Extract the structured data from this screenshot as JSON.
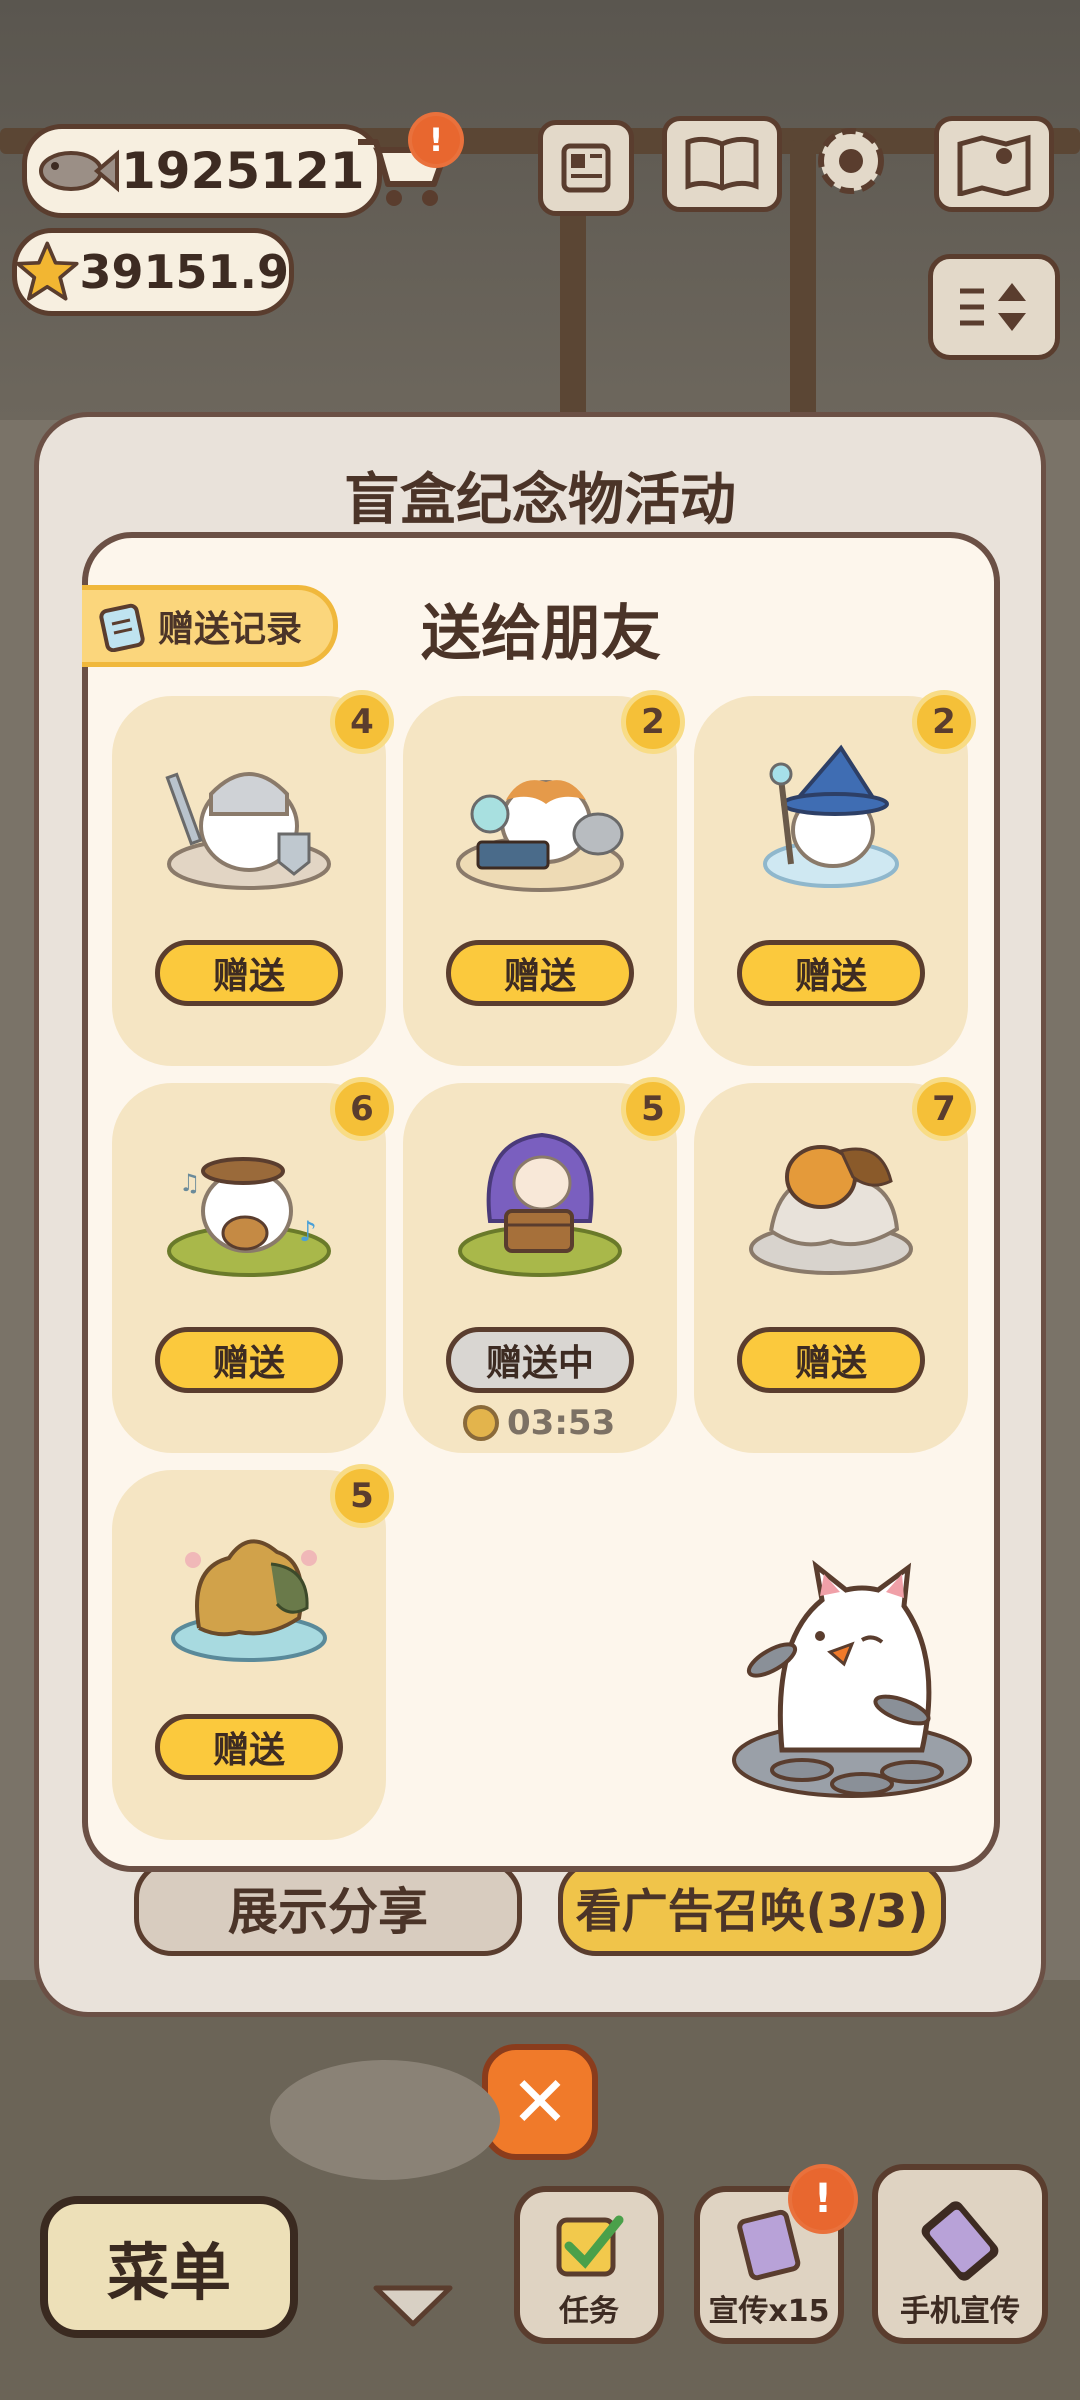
{
  "currency": {
    "fish_amount": "1925121",
    "star_amount": "39151.9"
  },
  "top_icons": {
    "shop_alert": "!"
  },
  "outer_panel": {
    "title": "盲盒纪念物活动",
    "share_label": "展示分享",
    "ad_label": "看广告召唤(3/3)"
  },
  "dialog": {
    "title": "送给朋友",
    "record_label": "赠送记录",
    "items": [
      {
        "count": "4",
        "button": "赠送"
      },
      {
        "count": "2",
        "button": "赠送"
      },
      {
        "count": "2",
        "button": "赠送"
      },
      {
        "count": "6",
        "button": "赠送"
      },
      {
        "count": "5",
        "button": "赠送中",
        "timer": "03:53"
      },
      {
        "count": "7",
        "button": "赠送"
      },
      {
        "count": "5",
        "button": "赠送"
      }
    ]
  },
  "close_label": "✕",
  "dock": {
    "menu_label": "菜单",
    "task_label": "任务",
    "promo_label": "宣传x15",
    "phone_promo_label": "手机宣传",
    "promo_alert": "!"
  },
  "colors": {
    "accent": "#fbc93d",
    "panel": "#fdf6ec",
    "card": "#f5e5c3",
    "border": "#5a3d2e",
    "close": "#f07a2a"
  }
}
